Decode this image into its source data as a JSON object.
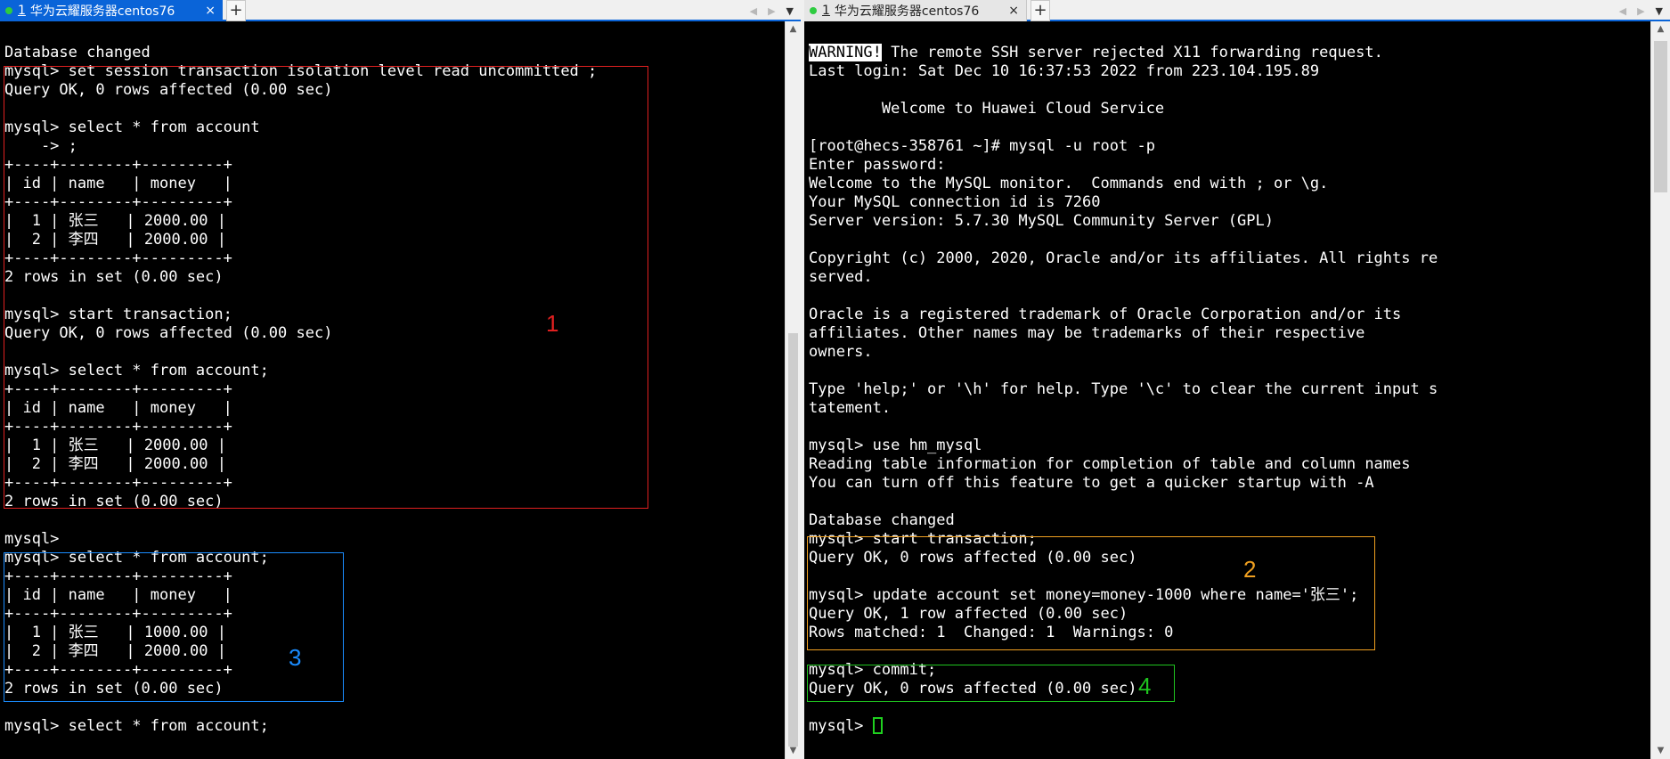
{
  "colors": {
    "tab_active": "#0a64d8",
    "connected_dot": "#2ecc40",
    "box1": "#e02020",
    "box2": "#f0a020",
    "box3": "#1a8cff",
    "box4": "#1fc41f",
    "cursor": "#1fd11f"
  },
  "left": {
    "tab": {
      "number": "1",
      "title": "华为云耀服务器centos76",
      "close": "×"
    },
    "add": "+",
    "nav": {
      "prev": "◀",
      "next": "▶",
      "menu": "▼"
    },
    "scroll": {
      "up": "▲",
      "down": "▼"
    },
    "lines": [
      "",
      "Database changed",
      "mysql> set session transaction isolation level read uncommitted ;",
      "Query OK, 0 rows affected (0.00 sec)",
      "",
      "mysql> select * from account",
      "    -> ;",
      "+----+--------+---------+",
      "| id | name   | money   |",
      "+----+--------+---------+",
      "|  1 | 张三   | 2000.00 |",
      "|  2 | 李四   | 2000.00 |",
      "+----+--------+---------+",
      "2 rows in set (0.00 sec)",
      "",
      "mysql> start transaction;",
      "Query OK, 0 rows affected (0.00 sec)",
      "",
      "mysql> select * from account;",
      "+----+--------+---------+",
      "| id | name   | money   |",
      "+----+--------+---------+",
      "|  1 | 张三   | 2000.00 |",
      "|  2 | 李四   | 2000.00 |",
      "+----+--------+---------+",
      "2 rows in set (0.00 sec)",
      "",
      "mysql>",
      "mysql> select * from account;",
      "+----+--------+---------+",
      "| id | name   | money   |",
      "+----+--------+---------+",
      "|  1 | 张三   | 1000.00 |",
      "|  2 | 李四   | 2000.00 |",
      "+----+--------+---------+",
      "2 rows in set (0.00 sec)",
      "",
      "mysql> select * from account;"
    ],
    "annotations": {
      "label1": "1",
      "label3": "3"
    }
  },
  "right": {
    "tab": {
      "number": "1",
      "title": "华为云耀服务器centos76",
      "close": "×"
    },
    "add": "+",
    "nav": {
      "prev": "◀",
      "next": "▶",
      "menu": "▼"
    },
    "scroll": {
      "up": "▲",
      "down": "▼"
    },
    "warning_word": "WARNING!",
    "lines": [
      "",
      " The remote SSH server rejected X11 forwarding request.",
      "Last login: Sat Dec 10 16:37:53 2022 from 223.104.195.89",
      "",
      "        Welcome to Huawei Cloud Service",
      "",
      "[root@hecs-358761 ~]# mysql -u root -p",
      "Enter password:",
      "Welcome to the MySQL monitor.  Commands end with ; or \\g.",
      "Your MySQL connection id is 7260",
      "Server version: 5.7.30 MySQL Community Server (GPL)",
      "",
      "Copyright (c) 2000, 2020, Oracle and/or its affiliates. All rights re",
      "served.",
      "",
      "Oracle is a registered trademark of Oracle Corporation and/or its",
      "affiliates. Other names may be trademarks of their respective",
      "owners.",
      "",
      "Type 'help;' or '\\h' for help. Type '\\c' to clear the current input s",
      "tatement.",
      "",
      "mysql> use hm_mysql",
      "Reading table information for completion of table and column names",
      "You can turn off this feature to get a quicker startup with -A",
      "",
      "Database changed",
      "mysql> start transaction;",
      "Query OK, 0 rows affected (0.00 sec)",
      "",
      "mysql> update account set money=money-1000 where name='张三';",
      "Query OK, 1 row affected (0.00 sec)",
      "Rows matched: 1  Changed: 1  Warnings: 0",
      "",
      "mysql> commit;",
      "Query OK, 0 rows affected (0.00 sec)",
      "",
      "mysql> "
    ],
    "annotations": {
      "label2": "2",
      "label4": "4"
    }
  }
}
